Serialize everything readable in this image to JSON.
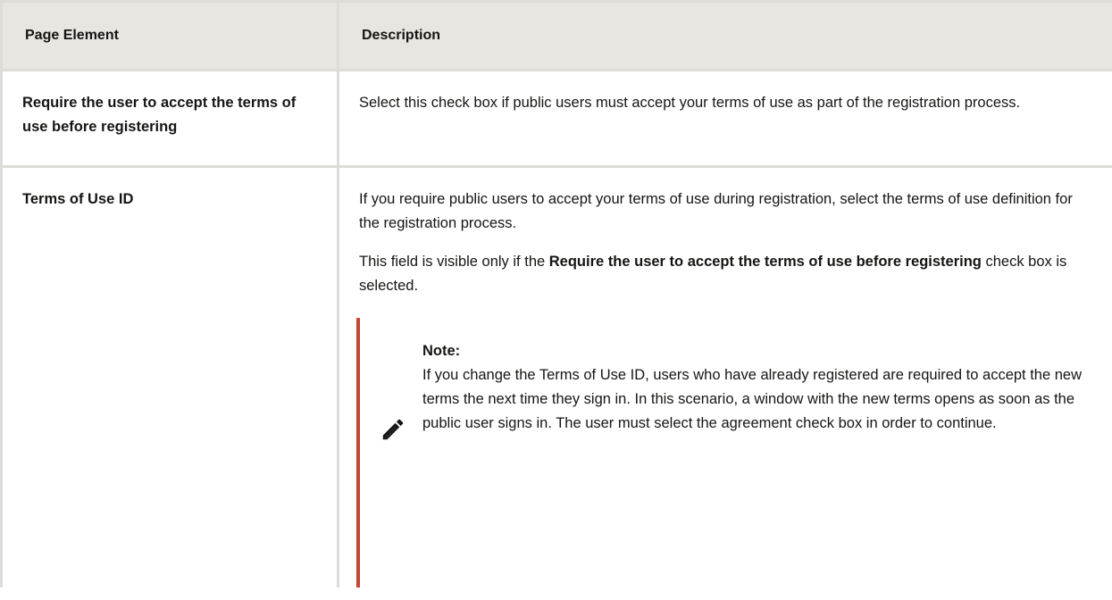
{
  "table": {
    "headers": {
      "page_element": "Page Element",
      "description": "Description"
    },
    "rows": [
      {
        "element": "Require the user to accept the terms of use before registering",
        "description": "Select this check box if public users must accept your terms of use as part of the registration process."
      },
      {
        "element": "Terms of Use ID",
        "description": "If you require public users to accept your terms of use during registration, select the terms of use definition for the registration process.",
        "visibility": {
          "before": "This field is visible only if the ",
          "bold": "Require the user to accept the terms of use before registering",
          "after": " check box is selected."
        },
        "note": {
          "icon": "pencil-icon",
          "title": "Note:",
          "text": "If you change the Terms of Use ID, users who have already registered are required to accept the new terms the next time they sign in. In this scenario, a window with the new terms opens as soon as the public user signs in. The user must select the agreement check box in order to continue."
        }
      }
    ]
  },
  "colors": {
    "header_bg": "#e8e6e1",
    "border": "#dedcd7",
    "note_accent": "#c74634",
    "text": "#161513"
  }
}
